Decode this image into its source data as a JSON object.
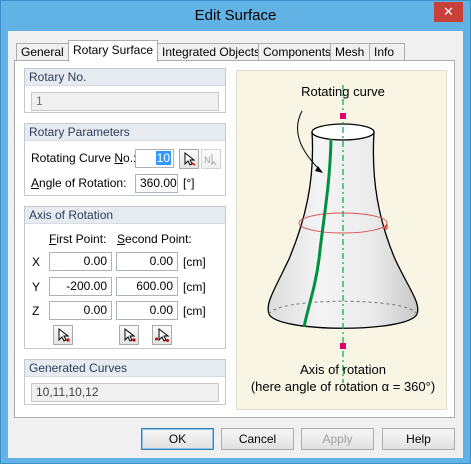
{
  "window": {
    "title": "Edit Surface",
    "close_glyph": "✕"
  },
  "tabs": [
    "General",
    "Rotary Surface",
    "Integrated Objects",
    "Components",
    "Mesh",
    "Info"
  ],
  "rotary_no": {
    "header": "Rotary No.",
    "value": "1"
  },
  "rotary_params": {
    "header": "Rotary Parameters",
    "curve_label_pre": "Rotating Curve ",
    "curve_label_u": "N",
    "curve_label_post": "o.:",
    "curve_value": "10",
    "angle_label_u": "A",
    "angle_label_post": "ngle of Rotation:",
    "angle_value": "360.00",
    "angle_unit": "[°]"
  },
  "axis": {
    "header": "Axis of Rotation",
    "first_u": "F",
    "first_post": "irst Point:",
    "second_u": "S",
    "second_post": "econd Point:",
    "rows": [
      {
        "label": "X",
        "first": "0.00",
        "second": "0.00",
        "unit": "[cm]"
      },
      {
        "label": "Y",
        "first": "-200.00",
        "second": "600.00",
        "unit": "[cm]"
      },
      {
        "label": "Z",
        "first": "0.00",
        "second": "0.00",
        "unit": "[cm]"
      }
    ]
  },
  "generated_curves": {
    "header": "Generated Curves",
    "value": "10,11,10,12"
  },
  "illustration": {
    "caption_top": "Rotating curve",
    "caption_axis": "Axis of rotation",
    "caption_angle": "(here angle of rotation α = 360°)",
    "colors": {
      "axis": "#00a651",
      "curve": "#00913f",
      "marker": "#e3006a",
      "circle": "#e05050"
    }
  },
  "buttons": {
    "ok": "OK",
    "cancel": "Cancel",
    "apply": "Apply",
    "help": "Help"
  }
}
